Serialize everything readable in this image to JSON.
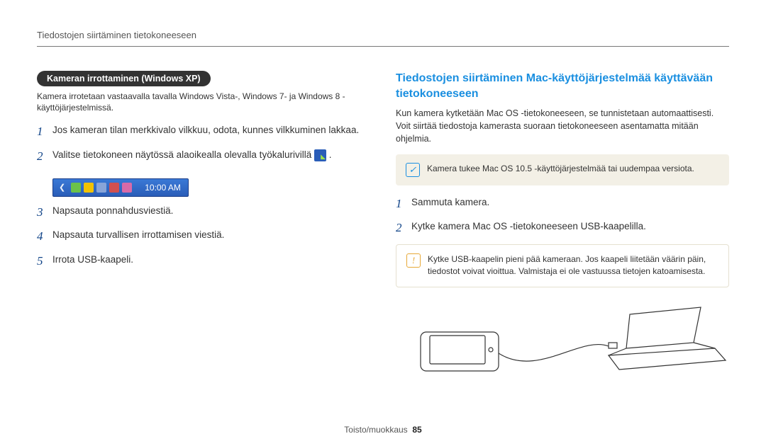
{
  "header": {
    "running_head": "Tiedostojen siirtäminen tietokoneeseen"
  },
  "left": {
    "pill": "Kameran irrottaminen (Windows XP)",
    "note": "Kamera irrotetaan vastaavalla tavalla Windows Vista-, Windows 7- ja Windows 8 -käyttöjärjestelmissä.",
    "steps": [
      "Jos kameran tilan merkkivalo vilkkuu, odota, kunnes vilkkuminen lakkaa.",
      "Valitse tietokoneen näytössä alaoikealla olevalla työkalurivillä",
      "Napsauta ponnahdusviestiä.",
      "Napsauta turvallisen irrottamisen viestiä.",
      "Irrota USB-kaapeli."
    ],
    "taskbar_time": "10:00 AM"
  },
  "right": {
    "title": "Tiedostojen siirtäminen Mac-käyttöjärjestelmää käyttävään tietokoneeseen",
    "intro": "Kun kamera kytketään Mac OS -tietokoneeseen, se tunnistetaan automaattisesti. Voit siirtää tiedostoja kamerasta suoraan tietokoneeseen asentamatta mitään ohjelmia.",
    "info_note": "Kamera tukee Mac OS 10.5 -käyttöjärjestelmää tai uudempaa versiota.",
    "steps": [
      "Sammuta kamera.",
      "Kytke kamera Mac OS -tietokoneeseen USB-kaapelilla."
    ],
    "warn_note": "Kytke USB-kaapelin pieni pää kameraan. Jos kaapeli liitetään väärin päin, tiedostot voivat vioittua. Valmistaja ei ole vastuussa tietojen katoamisesta."
  },
  "footer": {
    "section": "Toisto/muokkaus",
    "page": "85"
  }
}
